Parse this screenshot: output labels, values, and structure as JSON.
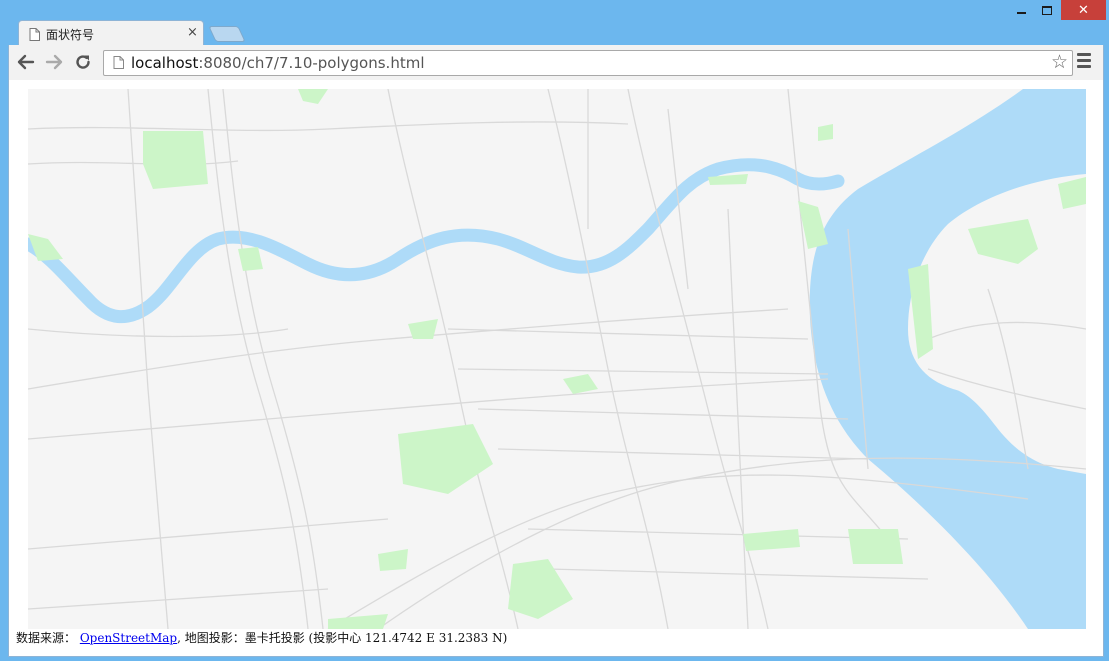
{
  "window": {
    "minimize": "minimize",
    "maximize": "maximize",
    "close_glyph": "✕"
  },
  "tab": {
    "title": "面状符号",
    "close_glyph": "×"
  },
  "toolbar": {
    "url_host": "localhost",
    "url_path": ":8080/ch7/7.10-polygons.html"
  },
  "icons": {
    "back": "back-arrow-icon",
    "forward": "forward-arrow-icon",
    "reload": "reload-icon",
    "page": "page-icon",
    "star": "bookmark-star-icon",
    "menu": "menu-icon"
  },
  "colors": {
    "water": "#aedbf8",
    "park": "#ccf5c8",
    "land": "#f5f5f5",
    "road": "#d9d9d9",
    "frame": "#6cb7ee"
  },
  "credit": {
    "prefix": "数据来源： ",
    "link": "OpenStreetMap",
    "suffix": ", 地图投影：墨卡托投影 (投影中心 121.4742 E 31.2383 N)"
  }
}
